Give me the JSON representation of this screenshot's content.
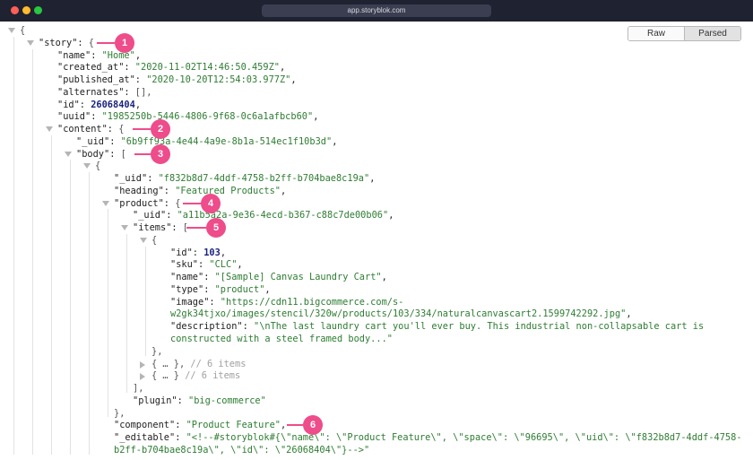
{
  "window": {
    "url": "app.storyblok.com"
  },
  "view_toggle": {
    "raw_label": "Raw",
    "parsed_label": "Parsed",
    "selected": "Parsed"
  },
  "annotations": [
    "1",
    "2",
    "3",
    "4",
    "5",
    "6"
  ],
  "json_lines": [
    {
      "key": "",
      "value": "{",
      "type": "punct"
    },
    {
      "key": "\"story\": ",
      "value": "{",
      "type": "punct"
    },
    {
      "key": "\"name\": ",
      "value": "\"Home\"",
      "type": "str",
      "suffix": ","
    },
    {
      "key": "\"created_at\": ",
      "value": "\"2020-11-02T14:46:50.459Z\"",
      "type": "str",
      "suffix": ","
    },
    {
      "key": "\"published_at\": ",
      "value": "\"2020-10-20T12:54:03.977Z\"",
      "type": "str",
      "suffix": ","
    },
    {
      "key": "\"alternates\": ",
      "value": "[],",
      "type": "punct"
    },
    {
      "key": "\"id\": ",
      "value": "26068404",
      "type": "num",
      "suffix": ","
    },
    {
      "key": "\"uuid\": ",
      "value": "\"1985250b-5446-4806-9f68-0c6a1afbcb60\"",
      "type": "str",
      "suffix": ","
    },
    {
      "key": "\"content\": ",
      "value": "{",
      "type": "punct"
    },
    {
      "key": "\"_uid\": ",
      "value": "\"6b9ff93a-4e44-4a9e-8b1a-514ec1f10b3d\"",
      "type": "str",
      "suffix": ","
    },
    {
      "key": "\"body\": ",
      "value": "[",
      "type": "punct"
    },
    {
      "key": "",
      "value": "{",
      "type": "punct"
    },
    {
      "key": "\"_uid\": ",
      "value": "\"f832b8d7-4ddf-4758-b2ff-b704bae8c19a\"",
      "type": "str",
      "suffix": ","
    },
    {
      "key": "\"heading\": ",
      "value": "\"Featured Products\"",
      "type": "str",
      "suffix": ","
    },
    {
      "key": "\"product\": ",
      "value": "{",
      "type": "punct"
    },
    {
      "key": "\"_uid\": ",
      "value": "\"a11b5a2a-9e36-4ecd-b367-c88c7de00b06\"",
      "type": "str",
      "suffix": ","
    },
    {
      "key": "\"items\": ",
      "value": "[",
      "type": "punct"
    },
    {
      "key": "",
      "value": "{",
      "type": "punct"
    },
    {
      "key": "\"id\": ",
      "value": "103",
      "type": "num",
      "suffix": ","
    },
    {
      "key": "\"sku\": ",
      "value": "\"CLC\"",
      "type": "str",
      "suffix": ","
    },
    {
      "key": "\"name\": ",
      "value": "\"[Sample] Canvas Laundry Cart\"",
      "type": "str",
      "suffix": ","
    },
    {
      "key": "\"type\": ",
      "value": "\"product\"",
      "type": "str",
      "suffix": ","
    },
    {
      "key": "\"image\": ",
      "value": "\"https://cdn11.bigcommerce.com/s-",
      "type": "str"
    },
    {
      "key": "",
      "value": "w2gk34tjxo/images/stencil/320w/products/103/334/naturalcanvascart2.1599742292.jpg\"",
      "type": "str",
      "suffix": ","
    },
    {
      "key": "\"description\": ",
      "value": "\"\\nThe last laundry cart you'll ever buy. This industrial non-collapsable cart is",
      "type": "str"
    },
    {
      "key": "",
      "value": "constructed with a steel framed body...\"",
      "type": "str"
    },
    {
      "key": "",
      "value": "},",
      "type": "punct"
    },
    {
      "key": "",
      "value": "{ … },",
      "type": "punct",
      "comment": " // 6 items"
    },
    {
      "key": "",
      "value": "{ … }",
      "type": "punct",
      "comment": " // 6 items"
    },
    {
      "key": "",
      "value": "],",
      "type": "punct"
    },
    {
      "key": "\"plugin\": ",
      "value": "\"big-commerce\"",
      "type": "str"
    },
    {
      "key": "",
      "value": "},",
      "type": "punct"
    },
    {
      "key": "\"component\": ",
      "value": "\"Product Feature\"",
      "type": "str",
      "suffix": ","
    },
    {
      "key": "\"_editable\": ",
      "value": "\"<!--#storyblok#{\\\"name\\\": \\\"Product Feature\\\", \\\"space\\\": \\\"96695\\\", \\\"uid\\\": \\\"f832b8d7-4ddf-4758-",
      "type": "str"
    },
    {
      "key": "",
      "value": "b2ff-b704bae8c19a\\\", \\\"id\\\": \\\"26068404\\\"}-->\"",
      "type": "str"
    }
  ]
}
